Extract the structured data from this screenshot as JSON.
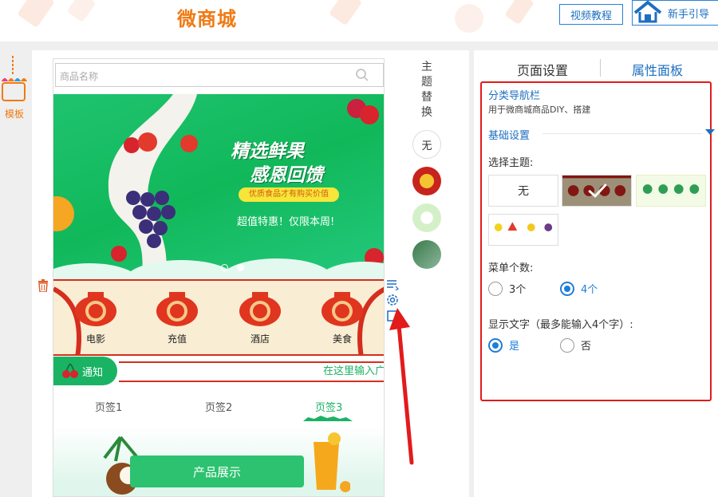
{
  "header": {
    "app_title": "微商城",
    "video_tutorial": "视频教程",
    "beginner_guide": "新手引导"
  },
  "left_tool": {
    "label": "模板"
  },
  "canvas": {
    "search_placeholder": "商品名称",
    "banner": {
      "headline1": "精选鲜果",
      "headline2": "感恩回馈",
      "slogan": "优质食品才有购买价值",
      "subtitle": "超值特惠！仅限本周!"
    },
    "nav_items": [
      "电影",
      "充值",
      "酒店",
      "美食"
    ],
    "notice": {
      "label": "通知",
      "text": "在这里输入广"
    },
    "tabs": [
      "页签1",
      "页签2",
      "页签3"
    ],
    "active_tab": "页签3",
    "product_showcase": "产品展示"
  },
  "theme_column": {
    "title": [
      "主",
      "题",
      "替",
      "换"
    ],
    "none_option": "无"
  },
  "right_panel": {
    "tabs": [
      "页面设置",
      "属性面板"
    ],
    "active_tab": "属性面板",
    "section_title": "分类导航栏",
    "section_desc": "用于微商城商品DIY、搭建",
    "basic_settings": "基础设置",
    "choose_theme_label": "选择主题:",
    "theme_none": "无",
    "menu_count_label": "菜单个数:",
    "menu_count_options": [
      "3个",
      "4个"
    ],
    "menu_count_selected": "4个",
    "show_text_label": "显示文字（最多能输入4个字）:",
    "show_text_options": [
      "是",
      "否"
    ],
    "show_text_selected": "是"
  },
  "colors": {
    "accent_blue": "#1e6fc0",
    "brand_orange": "#f07a14",
    "highlight_red": "#e21b1b",
    "green": "#1ab364"
  }
}
